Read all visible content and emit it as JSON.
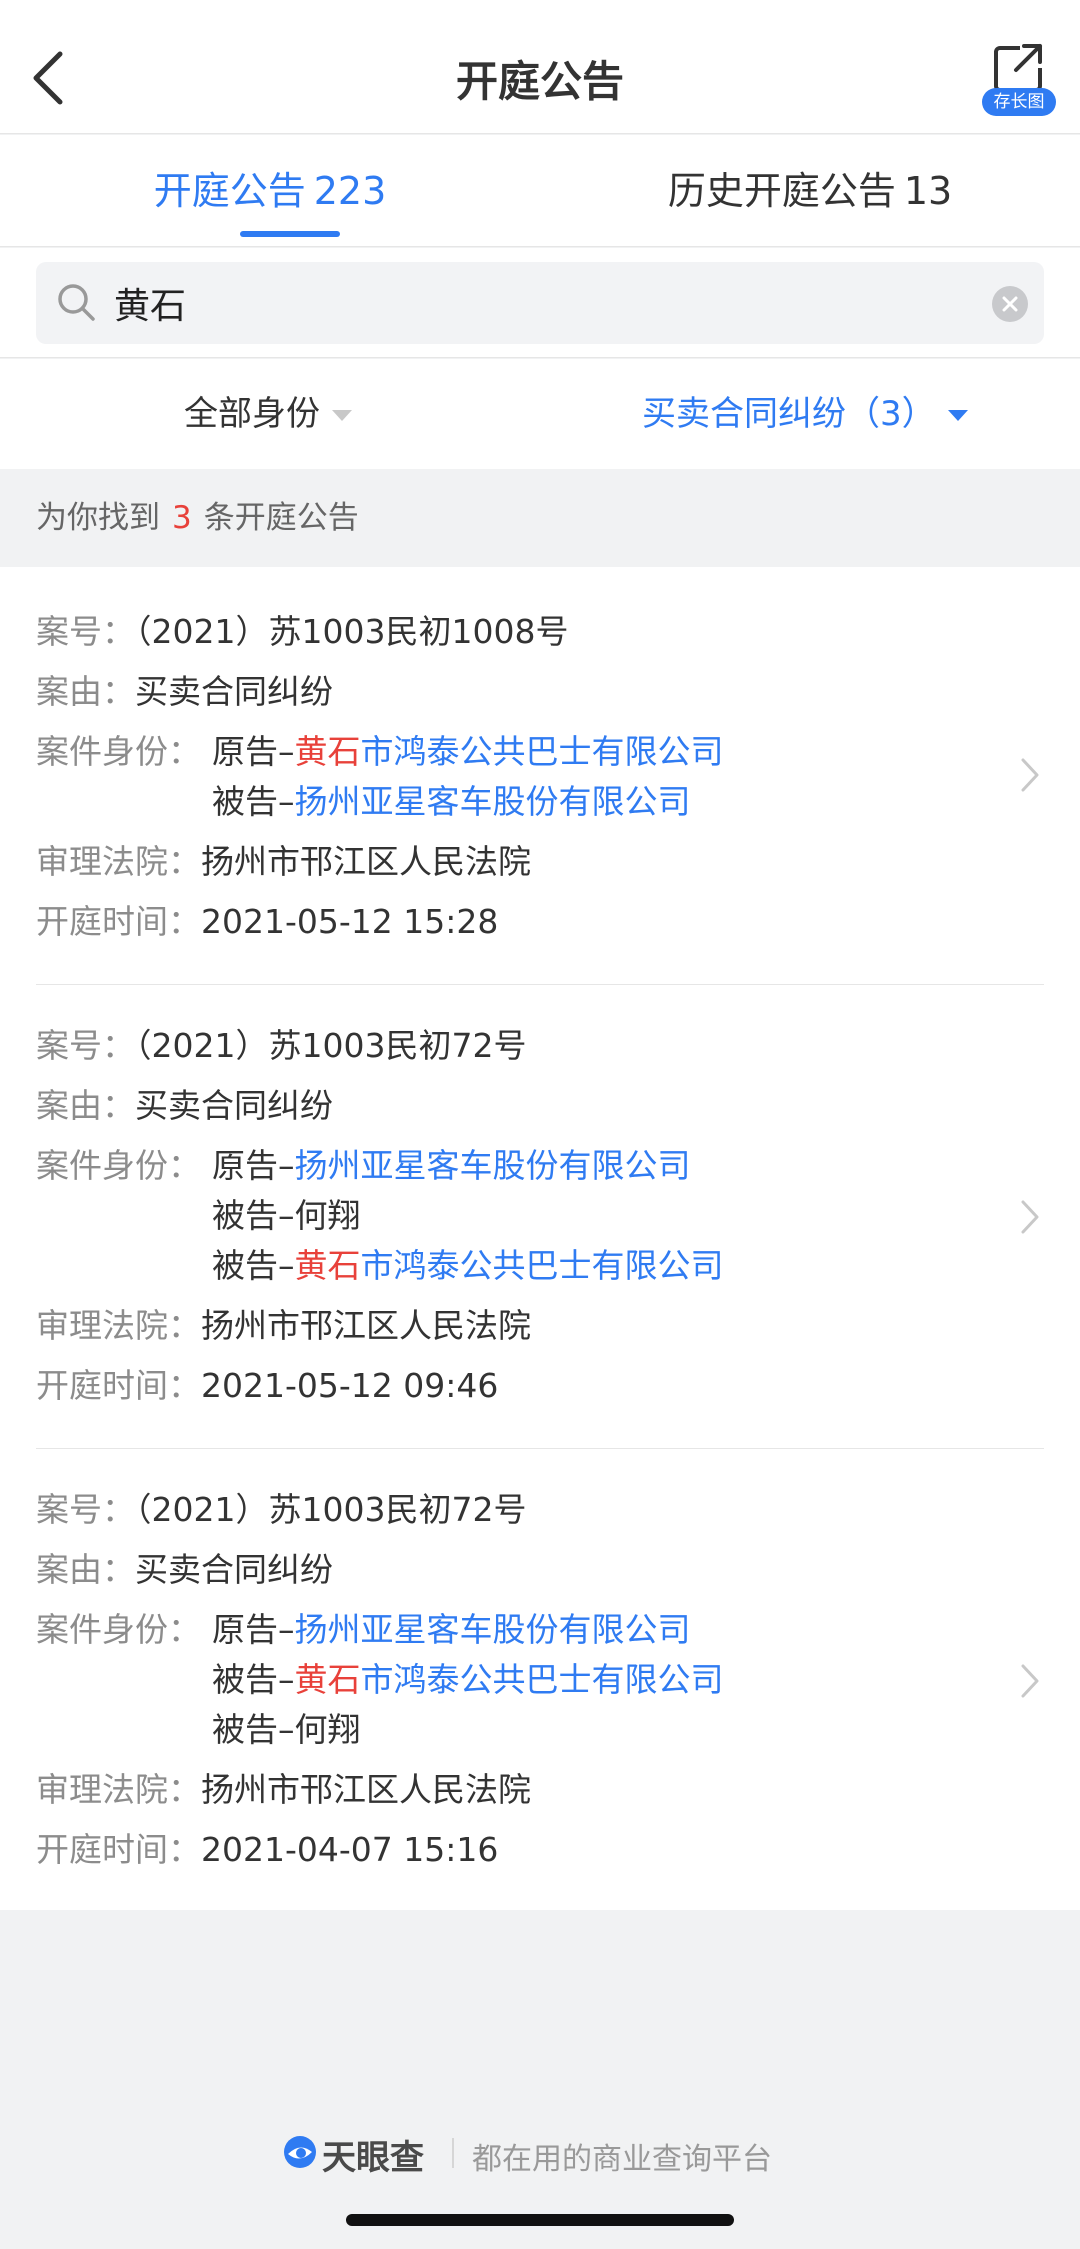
{
  "nav": {
    "title": "开庭公告",
    "save_badge": "存长图"
  },
  "tabs": [
    {
      "label": "开庭公告",
      "count": "223"
    },
    {
      "label": "历史开庭公告",
      "count": "13"
    }
  ],
  "search": {
    "value": "黄石",
    "placeholder": ""
  },
  "filters": {
    "identity": "全部身份",
    "case_type": "买卖合同纠纷（3）"
  },
  "result": {
    "prefix": "为你找到",
    "count": "3",
    "suffix": "条开庭公告"
  },
  "labels": {
    "case_no": "案号：",
    "cause": "案由：",
    "identity": "案件身份：",
    "court": "审理法院：",
    "time": "开庭时间："
  },
  "cases": [
    {
      "case_no": "（2021）苏1003民初1008号",
      "cause": "买卖合同纠纷",
      "parties": [
        {
          "role": "原告–",
          "hl": "黄石",
          "company": "市鸿泰公共巴士有限公司"
        },
        {
          "role": "被告–",
          "hl": "",
          "company": "扬州亚星客车股份有限公司"
        }
      ],
      "court": "扬州市邗江区人民法院",
      "time": "2021-05-12 15:28"
    },
    {
      "case_no": "（2021）苏1003民初72号",
      "cause": "买卖合同纠纷",
      "parties": [
        {
          "role": "原告–",
          "hl": "",
          "company": "扬州亚星客车股份有限公司"
        },
        {
          "role": "被告–何翔",
          "hl": "",
          "company": ""
        },
        {
          "role": "被告–",
          "hl": "黄石",
          "company": "市鸿泰公共巴士有限公司"
        }
      ],
      "court": "扬州市邗江区人民法院",
      "time": "2021-05-12 09:46"
    },
    {
      "case_no": "（2021）苏1003民初72号",
      "cause": "买卖合同纠纷",
      "parties": [
        {
          "role": "原告–",
          "hl": "",
          "company": "扬州亚星客车股份有限公司"
        },
        {
          "role": "被告–",
          "hl": "黄石",
          "company": "市鸿泰公共巴士有限公司"
        },
        {
          "role": "被告–何翔",
          "hl": "",
          "company": ""
        }
      ],
      "court": "扬州市邗江区人民法院",
      "time": "2021-04-07 15:16"
    }
  ],
  "footer": {
    "brand": "天眼查",
    "slogan": "都在用的商业查询平台"
  },
  "colors": {
    "accent": "#2f7bf2",
    "highlight": "#e8413a",
    "label": "#8c8c8c"
  }
}
